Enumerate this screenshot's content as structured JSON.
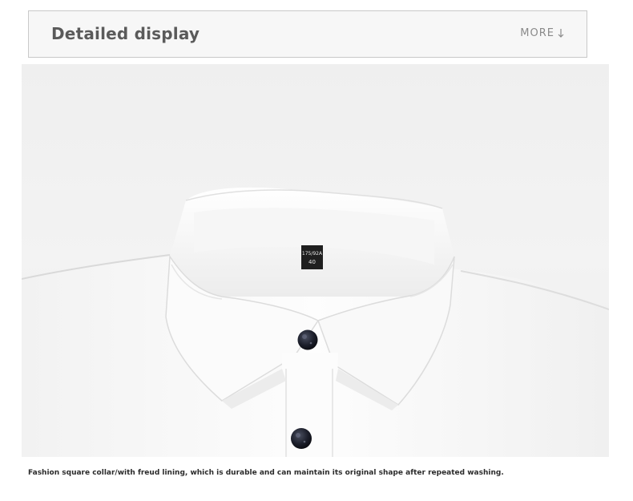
{
  "header": {
    "title": "Detailed display",
    "more_label": "MORE"
  },
  "photo": {
    "tag_line1": "175/92A",
    "tag_line2": "40"
  },
  "caption": "Fashion square collar/with freud lining, which is durable and can maintain its original shape after repeated washing.",
  "colors": {
    "header_bg": "#f7f7f7",
    "header_border": "#c9c9c9",
    "title": "#5a5a5a",
    "more": "#8a8a8a",
    "button": "#1c1f2b"
  }
}
